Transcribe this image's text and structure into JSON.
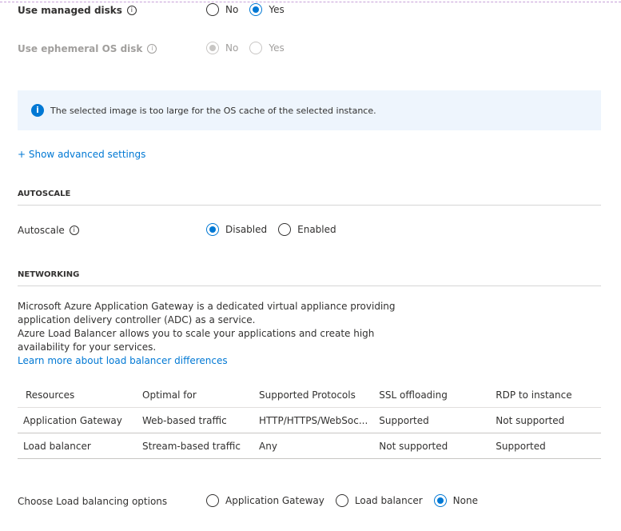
{
  "managed_disks": {
    "label": "Use managed disks",
    "options": [
      "No",
      "Yes"
    ],
    "selected": "Yes"
  },
  "ephemeral": {
    "label": "Use ephemeral OS disk",
    "options": [
      "No",
      "Yes"
    ],
    "selected": "No",
    "disabled": true
  },
  "info_message": "The selected image is too large for the OS cache of the selected instance.",
  "advanced_link": "+ Show advanced settings",
  "autoscale": {
    "heading": "AUTOSCALE",
    "label": "Autoscale",
    "options": [
      "Disabled",
      "Enabled"
    ],
    "selected": "Disabled"
  },
  "networking": {
    "heading": "NETWORKING",
    "desc1": "Microsoft Azure Application Gateway is a dedicated virtual appliance providing application delivery controller (ADC) as a service.",
    "desc2": "Azure Load Balancer allows you to scale your applications and create high availability for your services.",
    "link": "Learn more about load balancer differences",
    "table": {
      "headers": [
        "Resources",
        "Optimal for",
        "Supported Protocols",
        "SSL offloading",
        "RDP to instance"
      ],
      "rows": [
        [
          "Application Gateway",
          "Web-based traffic",
          "HTTP/HTTPS/WebSoc...",
          "Supported",
          "Not supported"
        ],
        [
          "Load balancer",
          "Stream-based traffic",
          "Any",
          "Not supported",
          "Supported"
        ]
      ]
    }
  },
  "lb_options": {
    "label": "Choose Load balancing options",
    "options": [
      "Application Gateway",
      "Load balancer",
      "None"
    ],
    "selected": "None"
  },
  "accent": "#0078d4"
}
